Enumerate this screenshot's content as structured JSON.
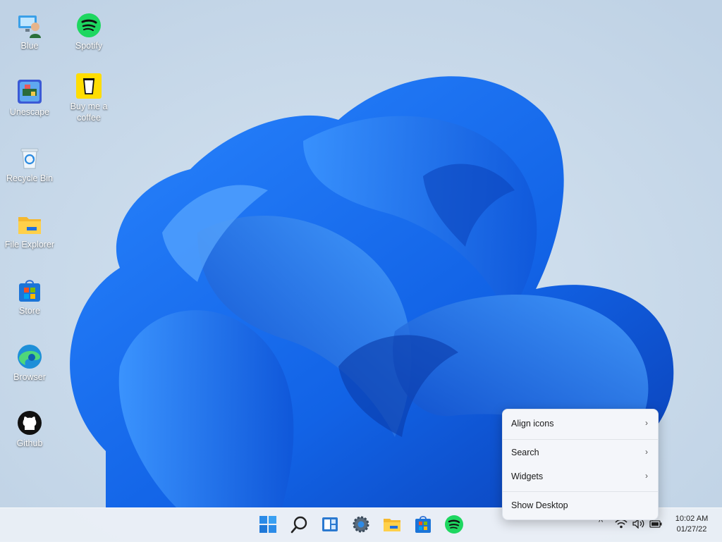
{
  "desktop": {
    "icons": [
      {
        "label": "Blue",
        "icon": "user-computer-icon"
      },
      {
        "label": "Spotify",
        "icon": "spotify-icon"
      },
      {
        "label": "Unescape",
        "icon": "unescape-game-icon"
      },
      {
        "label": "Buy me a coffee",
        "icon": "coffee-cup-icon"
      },
      {
        "label": "Recycle Bin",
        "icon": "recycle-bin-icon"
      },
      {
        "label": "File Explorer",
        "icon": "folder-icon"
      },
      {
        "label": "Store",
        "icon": "store-bag-icon"
      },
      {
        "label": "Browser",
        "icon": "edge-browser-icon"
      },
      {
        "label": "Github",
        "icon": "github-icon"
      }
    ]
  },
  "context_menu": {
    "items": [
      {
        "label": "Align icons",
        "has_submenu": true
      },
      {
        "label": "Search",
        "has_submenu": true
      },
      {
        "label": "Widgets",
        "has_submenu": true
      },
      {
        "label": "Show Desktop",
        "has_submenu": false
      }
    ],
    "chevron": "›"
  },
  "taskbar": {
    "pinned": [
      "start-windows-icon",
      "search-icon",
      "widgets-icon",
      "settings-gear-icon",
      "file-explorer-icon",
      "store-icon",
      "spotify-icon"
    ],
    "tray": {
      "overflow_glyph": "^",
      "icons": [
        "wifi-icon",
        "volume-icon",
        "battery-icon"
      ]
    },
    "clock": {
      "time": "10:02 AM",
      "date": "01/27/22"
    }
  },
  "colors": {
    "accent_blue": "#1f6fe0",
    "spotify_green": "#1ed760",
    "coffee_yellow": "#ffdd00"
  }
}
